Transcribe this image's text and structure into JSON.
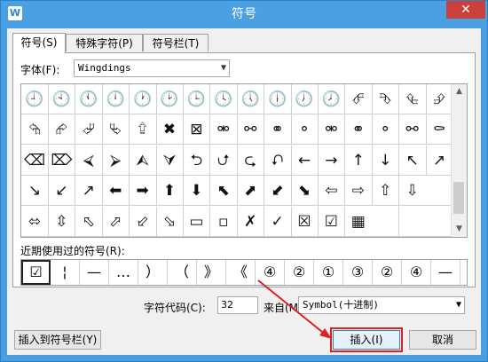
{
  "window": {
    "title": "符号",
    "app_icon": "W",
    "close": "✕"
  },
  "tabs": [
    {
      "label": "符号(S)"
    },
    {
      "label": "特殊字符(P)"
    },
    {
      "label": "符号栏(T)"
    }
  ],
  "font": {
    "label": "字体(F):",
    "value": "Wingdings"
  },
  "grid": {
    "rows": [
      [
        "🕘",
        "🕙",
        "🕚",
        "🕛",
        "🕐",
        "🕑",
        "🕒",
        "🕓",
        "🕔",
        "🕕",
        "🕖",
        "🕗",
        "⮶",
        "⮷",
        "⮴",
        "⮵"
      ],
      [
        "⮲",
        "⮳",
        "⮰",
        "⮱",
        "⮸",
        "✖",
        "⊠",
        "⚮",
        "⚯",
        "⚭",
        "⚬",
        "⚮",
        "⚭",
        "⚬",
        "⚯",
        "⚰"
      ],
      [
        "⌫",
        "⌦",
        "⮘",
        "⮚",
        "⮙",
        "⮛",
        "⮌",
        "⮍",
        "⮎",
        "⮏",
        "←",
        "→",
        "↑",
        "↓",
        "↖",
        "↗"
      ],
      [
        "↘",
        "↙",
        "↗",
        "⬅",
        "➡",
        "⬆",
        "⬇",
        "⬉",
        "⬈",
        "⬋",
        "⬊",
        "⇦",
        "⇨",
        "⇧",
        "⇩",
        ""
      ],
      [
        "⬄",
        "⇳",
        "⬁",
        "⬀",
        "⬃",
        "⬂",
        "▭",
        "▫",
        "✗",
        "✓",
        "☒",
        "☑",
        "▦",
        "",
        "",
        ""
      ]
    ]
  },
  "recent": {
    "label": "近期使用过的符号(R):",
    "items": [
      "☑",
      "¦",
      "—",
      "…",
      "）",
      "（",
      "》",
      "《",
      "④",
      "②",
      "①",
      "③",
      "②",
      "④",
      "—"
    ]
  },
  "code": {
    "label": "字符代码(C):",
    "value": "32"
  },
  "from": {
    "label": "来自(M)",
    "value": "Symbol(十进制)"
  },
  "buttons": {
    "insert_to_bar": "插入到符号栏(Y)",
    "insert": "插入(I)",
    "cancel": "取消"
  },
  "colors": {
    "titlebar": "#4aa0e2",
    "close": "#c9413a",
    "highlight": "#e02020"
  }
}
